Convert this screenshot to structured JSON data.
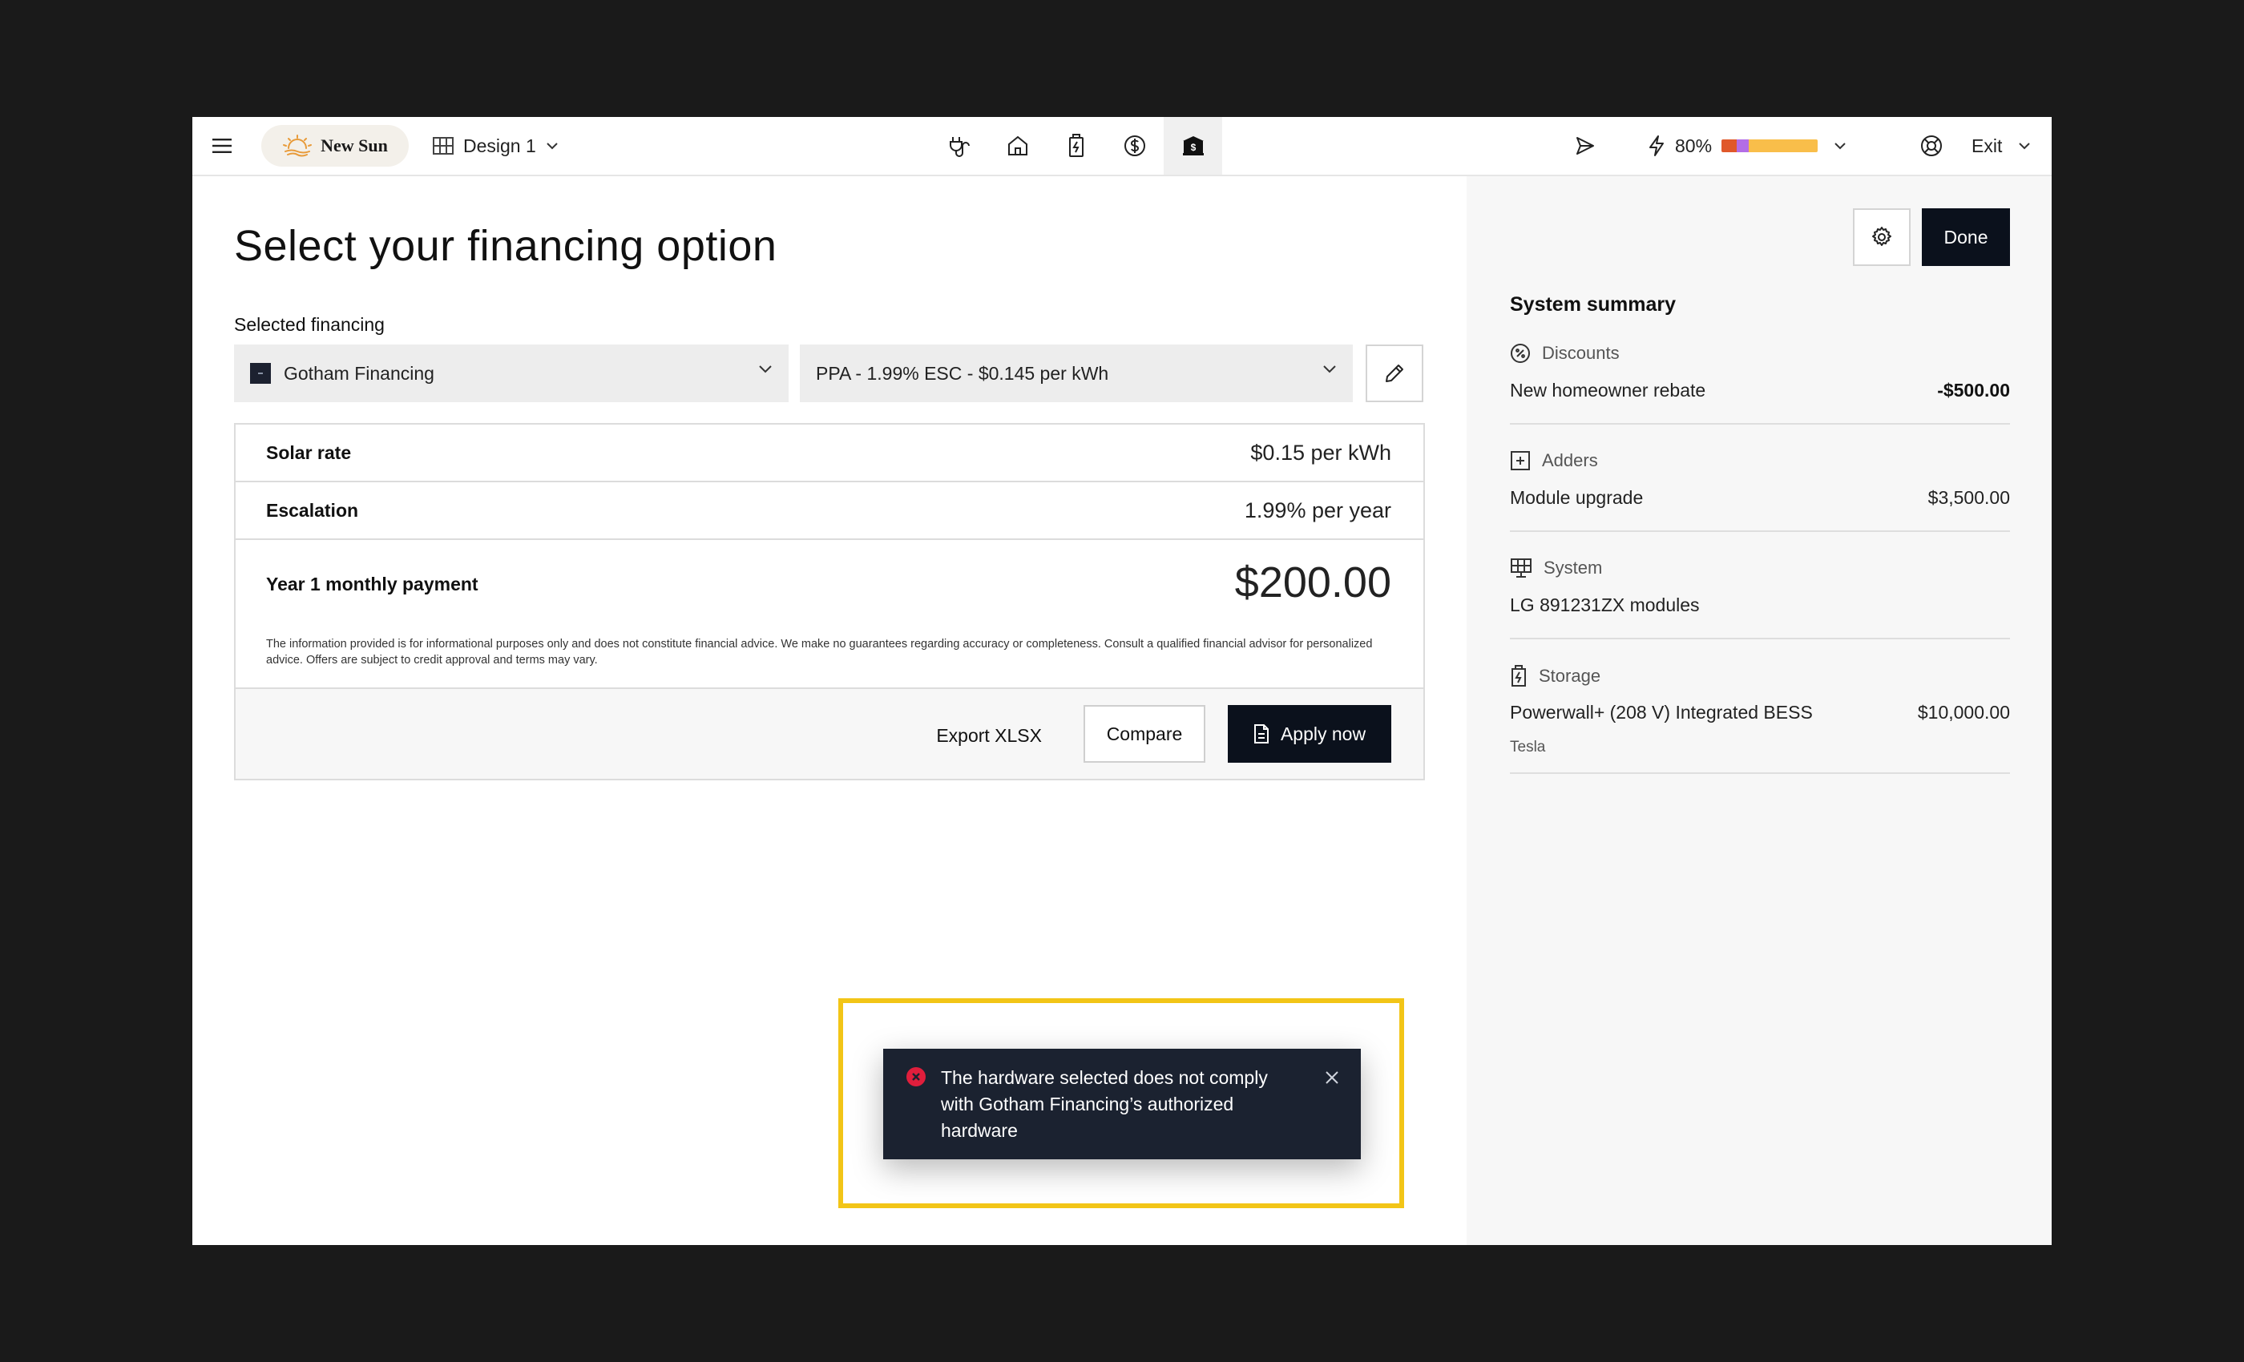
{
  "brand": {
    "name": "New Sun"
  },
  "design": {
    "label": "Design 1"
  },
  "nav_icons": [
    "plug-icon",
    "house-icon",
    "battery-icon",
    "dollar-coin-icon",
    "bank-icon"
  ],
  "energy": {
    "percent_label": "80%",
    "bar_colors": [
      "#e0582a",
      "#b36de6",
      "#f9be4a"
    ],
    "bar_fractions": [
      0.16,
      0.12,
      0.72
    ]
  },
  "exit": {
    "label": "Exit"
  },
  "page": {
    "title": "Select your financing option"
  },
  "financing": {
    "selected_label": "Selected financing",
    "provider": "Gotham Financing",
    "plan": "PPA - 1.99% ESC - $0.145 per kWh"
  },
  "details": {
    "solar_rate_label": "Solar rate",
    "solar_rate_value": "$0.15 per kWh",
    "escalation_label": "Escalation",
    "escalation_value": "1.99% per year",
    "payment_label": "Year 1 monthly payment",
    "payment_value": "$200.00",
    "disclaimer": "The information provided is for informational purposes only and does not constitute financial advice. We make no guarantees regarding accuracy or completeness. Consult a qualified financial advisor for personalized advice. Offers are subject to credit approval and terms may vary."
  },
  "actions": {
    "export": "Export XLSX",
    "compare": "Compare",
    "apply": "Apply now"
  },
  "toast": {
    "message": "The hardware selected does not comply with Gotham Financing’s authorized hardware"
  },
  "sidebar": {
    "done": "Done",
    "summary_title": "System summary",
    "sections": [
      {
        "heading": "Discounts",
        "item": "New homeowner rebate",
        "price": "-$500.00"
      },
      {
        "heading": "Adders",
        "item": "Module upgrade",
        "price": "$3,500.00"
      },
      {
        "heading": "System",
        "item": "LG 891231ZX modules"
      },
      {
        "heading": "Storage",
        "item": "Powerwall+ (208 V) Integrated BESS",
        "price": "$10,000.00",
        "sub": "Tesla"
      }
    ]
  },
  "colors": {
    "dark": "#0b111c",
    "toast_bg": "#1b2230",
    "error": "#e01e3c",
    "highlight": "#f2c517",
    "brand_sun": "#e89b3a"
  }
}
